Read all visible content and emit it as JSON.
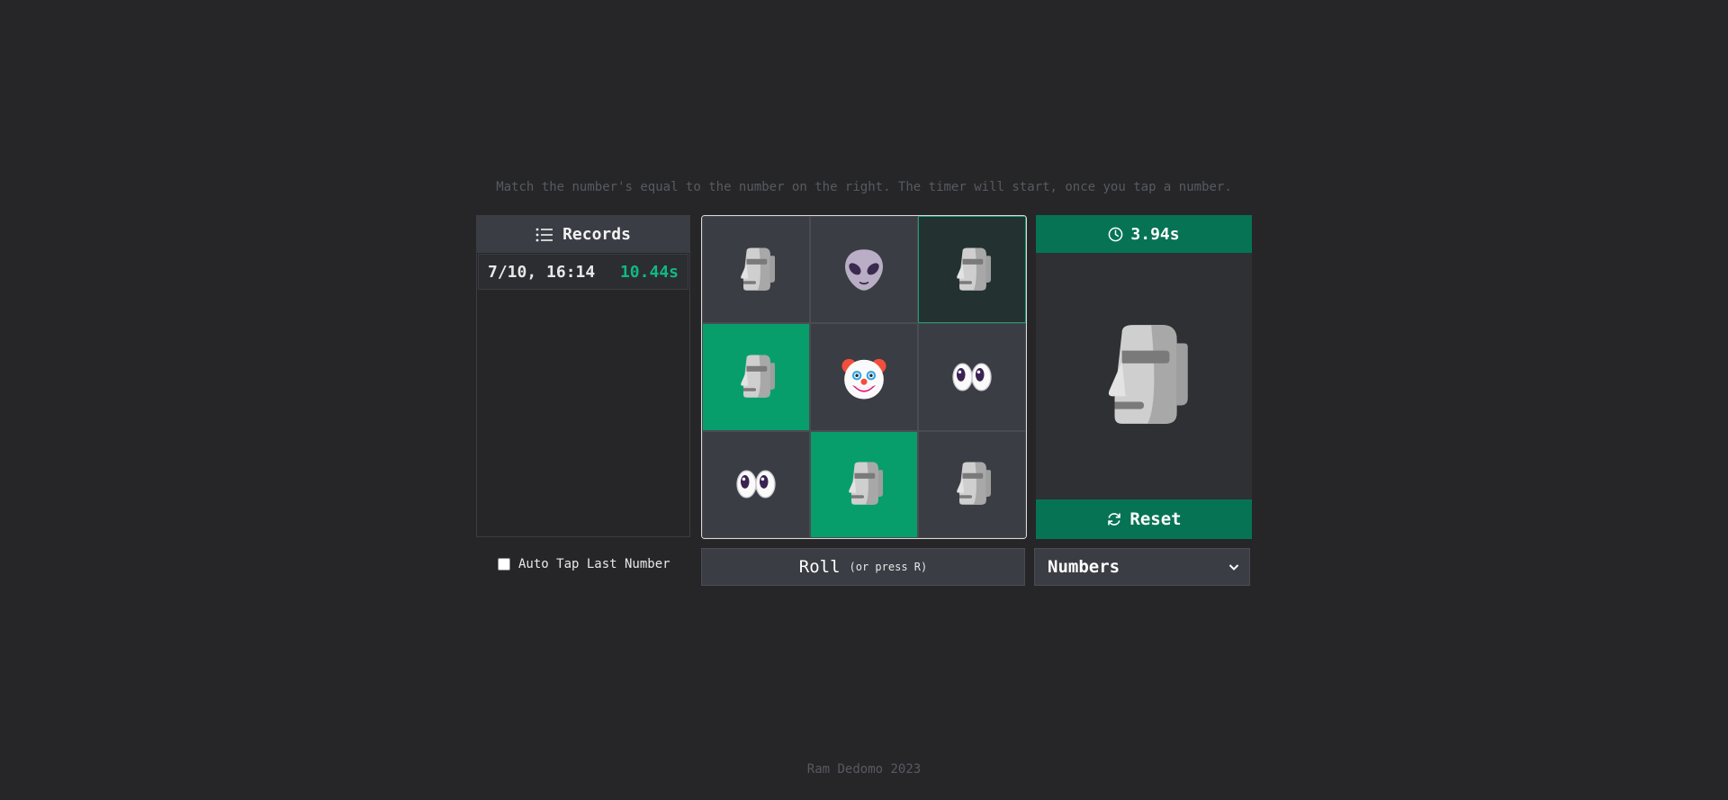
{
  "instructions": "Match the number's equal to the number on the right. The timer will start, once you tap a number.",
  "records": {
    "title": "Records",
    "icon": "list-icon",
    "items": [
      {
        "date": "7/10, 16:14",
        "time": "10.44s"
      }
    ]
  },
  "grid": {
    "cells": [
      {
        "emoji": "moai",
        "state": "default"
      },
      {
        "emoji": "alien",
        "state": "default"
      },
      {
        "emoji": "moai",
        "state": "focus"
      },
      {
        "emoji": "moai",
        "state": "hit"
      },
      {
        "emoji": "clown",
        "state": "default"
      },
      {
        "emoji": "eyes",
        "state": "default"
      },
      {
        "emoji": "eyes",
        "state": "default"
      },
      {
        "emoji": "moai",
        "state": "hit"
      },
      {
        "emoji": "moai",
        "state": "default"
      }
    ]
  },
  "target": {
    "timer": "3.94s",
    "timer_icon": "clock-icon",
    "emoji": "moai",
    "reset_label": "Reset",
    "reset_icon": "refresh-icon"
  },
  "controls": {
    "auto_tap_label": "Auto Tap Last Number",
    "auto_tap_checked": false,
    "roll_label": "Roll",
    "roll_hint": "(or press R)",
    "mode_selected": "Numbers"
  },
  "footer": "Ram Dedomo 2023",
  "colors": {
    "accent": "#067354",
    "hit": "#089e6c",
    "record_time": "#10b981"
  }
}
